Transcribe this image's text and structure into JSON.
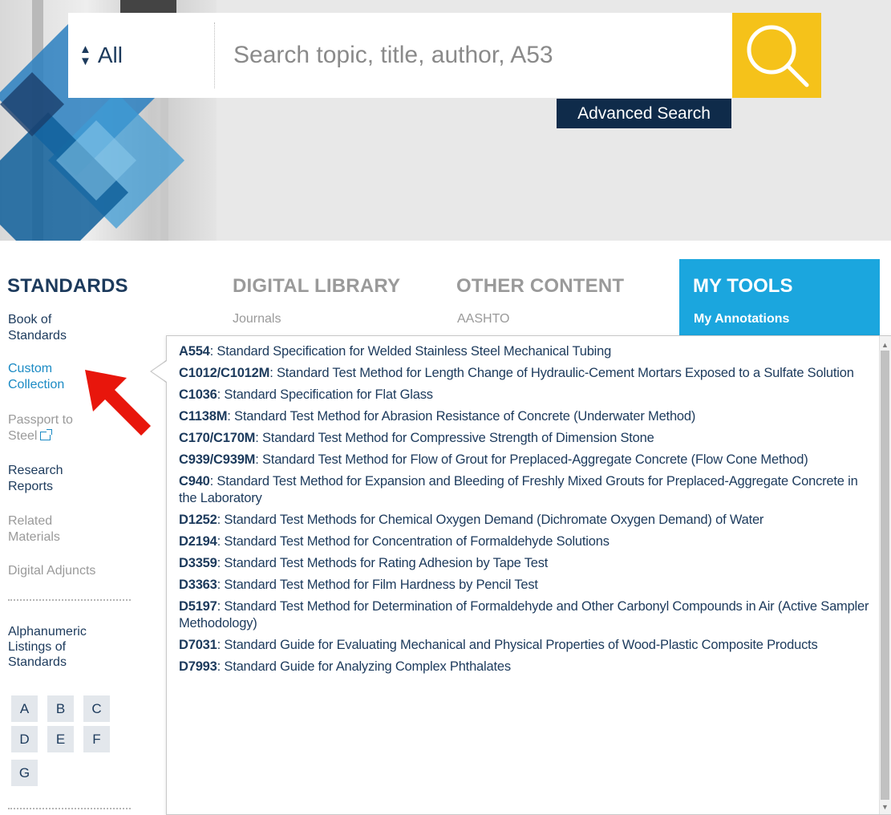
{
  "search": {
    "scope_label": "All",
    "placeholder": "Search topic, title, author, A53",
    "advanced_label": "Advanced Search"
  },
  "nav": {
    "standards": "STANDARDS",
    "digital_library": "DIGITAL LIBRARY",
    "digital_library_sub": "Journals",
    "other_content": "OTHER CONTENT",
    "other_content_sub": "AASHTO",
    "my_tools": "MY TOOLS",
    "my_tools_sub": "My Annotations"
  },
  "sidebar": {
    "book_of_standards_1": "Book of",
    "book_of_standards_2": "Standards",
    "custom_collection_1": "Custom",
    "custom_collection_2": "Collection",
    "passport_1": "Passport to",
    "passport_2": "Steel",
    "research_1": "Research",
    "research_2": "Reports",
    "related_1": "Related",
    "related_2": "Materials",
    "digital_adjuncts": "Digital Adjuncts",
    "alpha_title_1": "Alphanumeric",
    "alpha_title_2": "Listings of",
    "alpha_title_3": "Standards",
    "letters": [
      "A",
      "B",
      "C",
      "D",
      "E",
      "F",
      "G"
    ]
  },
  "popup": {
    "items": [
      {
        "code": "A554",
        "title": ": Standard Specification for Welded Stainless Steel Mechanical Tubing"
      },
      {
        "code": "C1012/C1012M",
        "title": ": Standard Test Method for Length Change of Hydraulic-Cement Mortars Exposed to a Sulfate Solution"
      },
      {
        "code": "C1036",
        "title": ": Standard Specification for Flat Glass"
      },
      {
        "code": "C1138M",
        "title": ": Standard Test Method for Abrasion Resistance of Concrete (Underwater Method)"
      },
      {
        "code": "C170/C170M",
        "title": ": Standard Test Method for Compressive Strength of Dimension Stone"
      },
      {
        "code": "C939/C939M",
        "title": ": Standard Test Method for Flow of Grout for Preplaced-Aggregate Concrete (Flow Cone Method)"
      },
      {
        "code": "C940",
        "title": ": Standard Test Method for Expansion and Bleeding of Freshly Mixed Grouts for Preplaced-Aggregate Concrete in the Laboratory"
      },
      {
        "code": "D1252",
        "title": ": Standard Test Methods for Chemical Oxygen Demand (Dichromate Oxygen Demand) of Water"
      },
      {
        "code": "D2194",
        "title": ": Standard Test Method for Concentration of Formaldehyde Solutions"
      },
      {
        "code": "D3359",
        "title": ": Standard Test Methods for Rating Adhesion by Tape Test"
      },
      {
        "code": "D3363",
        "title": ": Standard Test Method for Film Hardness by Pencil Test"
      },
      {
        "code": "D5197",
        "title": ": Standard Test Method for Determination of Formaldehyde and Other Carbonyl Compounds in Air (Active Sampler Methodology)"
      },
      {
        "code": "D7031",
        "title": ": Standard Guide for Evaluating Mechanical and Physical Properties of Wood-Plastic Composite Products"
      },
      {
        "code": "D7993",
        "title": ": Standard Guide for Analyzing Complex Phthalates"
      }
    ]
  },
  "colors": {
    "accent_yellow": "#f5c21a",
    "navy": "#0f2b4a",
    "tools_blue": "#1ba6de",
    "link_blue": "#1a8ac4",
    "arrow_red": "#e8160c"
  },
  "icons": {
    "search": "magnifier-icon",
    "scope": "sort-arrows-icon",
    "external": "external-link-icon",
    "pointer": "red-arrow-icon"
  }
}
